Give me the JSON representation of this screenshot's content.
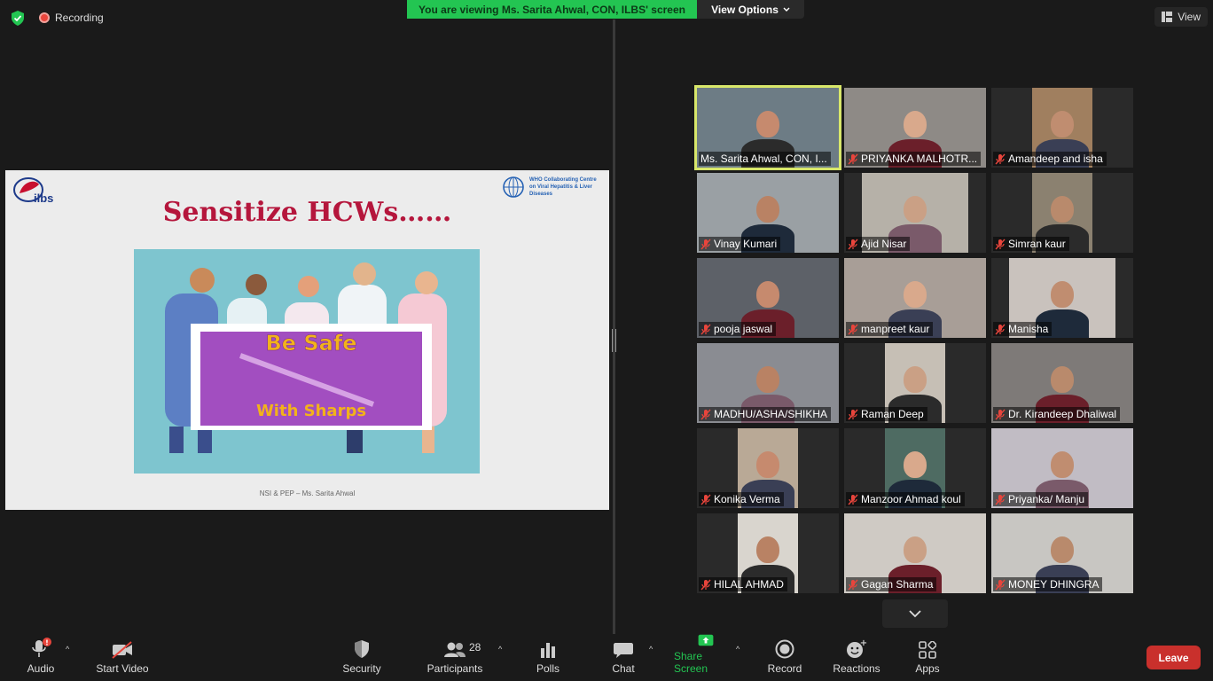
{
  "topbar": {
    "recording_label": "Recording",
    "banner_text": "You are viewing Ms. Sarita Ahwal, CON, ILBS' screen",
    "view_options_label": "View Options",
    "view_label": "View"
  },
  "slide": {
    "title": "Sensitize HCWs……",
    "logo_text": "ilbs",
    "who_text": "WHO Collaborating Centre on Viral Hepatitis & Liver Diseases",
    "poster_line1": "Be Safe",
    "poster_line2": "With Sharps",
    "footer": "NSI & PEP – Ms. Sarita Ahwal"
  },
  "participants": [
    {
      "name": "Ms. Sarita Ahwal, CON, I...",
      "muted": false,
      "active": true
    },
    {
      "name": "PRIYANKA MALHOTR...",
      "muted": true,
      "active": false
    },
    {
      "name": "Amandeep and isha",
      "muted": true,
      "active": false
    },
    {
      "name": "Vinay Kumari",
      "muted": true,
      "active": false
    },
    {
      "name": "Ajid Nisar",
      "muted": true,
      "active": false
    },
    {
      "name": "Simran kaur",
      "muted": true,
      "active": false
    },
    {
      "name": "pooja jaswal",
      "muted": true,
      "active": false
    },
    {
      "name": "manpreet kaur",
      "muted": true,
      "active": false
    },
    {
      "name": "Manisha",
      "muted": true,
      "active": false
    },
    {
      "name": "MADHU/ASHA/SHIKHA",
      "muted": true,
      "active": false
    },
    {
      "name": "Raman Deep",
      "muted": true,
      "active": false
    },
    {
      "name": "Dr. Kirandeep Dhaliwal",
      "muted": true,
      "active": false
    },
    {
      "name": "Konika Verma",
      "muted": true,
      "active": false
    },
    {
      "name": "Manzoor Ahmad koul",
      "muted": true,
      "active": false
    },
    {
      "name": "Priyanka/ Manju",
      "muted": true,
      "active": false
    },
    {
      "name": "HILAL AHMAD",
      "muted": true,
      "active": false
    },
    {
      "name": "Gagan Sharma",
      "muted": true,
      "active": false
    },
    {
      "name": "MONEY DHINGRA",
      "muted": true,
      "active": false
    }
  ],
  "toolbar": {
    "audio": "Audio",
    "start_video": "Start Video",
    "security": "Security",
    "participants": "Participants",
    "participants_count": "28",
    "polls": "Polls",
    "chat": "Chat",
    "share_screen": "Share Screen",
    "record": "Record",
    "reactions": "Reactions",
    "apps": "Apps",
    "leave": "Leave"
  },
  "colors": {
    "banner": "#23c552",
    "active_speaker": "#d8e76a",
    "leave": "#c9302c",
    "share": "#23c552",
    "slide_title": "#b5163c"
  }
}
